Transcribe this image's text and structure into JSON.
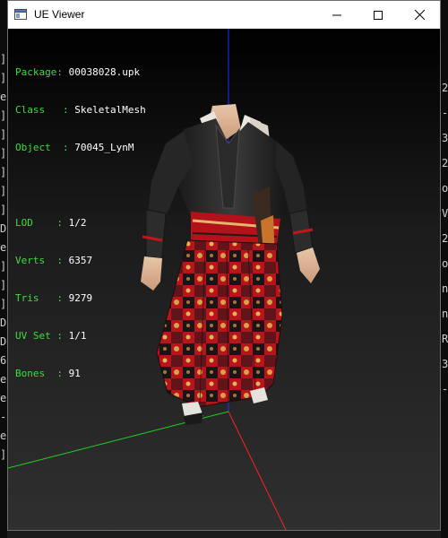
{
  "window": {
    "title": "UE Viewer",
    "buttons": {
      "minimize": "minimize-icon",
      "maximize": "maximize-icon",
      "close": "close-icon"
    }
  },
  "info": {
    "package_label": "Package",
    "package_value": "00038028.upk",
    "class_label": "Class",
    "class_value": "SkeletalMesh",
    "object_label": "Object",
    "object_value": "70045_LynM",
    "lod_label": "LOD",
    "lod_value": "1/2",
    "verts_label": "Verts",
    "verts_value": "6357",
    "tris_label": "Tris",
    "tris_value": "9279",
    "uvset_label": "UV Set",
    "uvset_value": "1/1",
    "bones_label": "Bones",
    "bones_value": "91",
    "sep": ":"
  },
  "background_left": [
    "]",
    "]",
    "e",
    "]",
    "]",
    "]",
    "]",
    "]",
    "]",
    "D",
    "e",
    "]",
    "]",
    "]",
    "D",
    "D",
    "6",
    "e",
    "e",
    "-",
    "e",
    "]"
  ],
  "background_right": [
    "2",
    "-",
    "3",
    "2",
    "o",
    "V",
    "2",
    "o",
    "n",
    "n",
    "R",
    "3",
    "-"
  ],
  "colors": {
    "label": "#3fdc3f",
    "value": "#ffffff",
    "axis_x": "#ff2020",
    "axis_y": "#20d020",
    "axis_z": "#2030ff"
  }
}
